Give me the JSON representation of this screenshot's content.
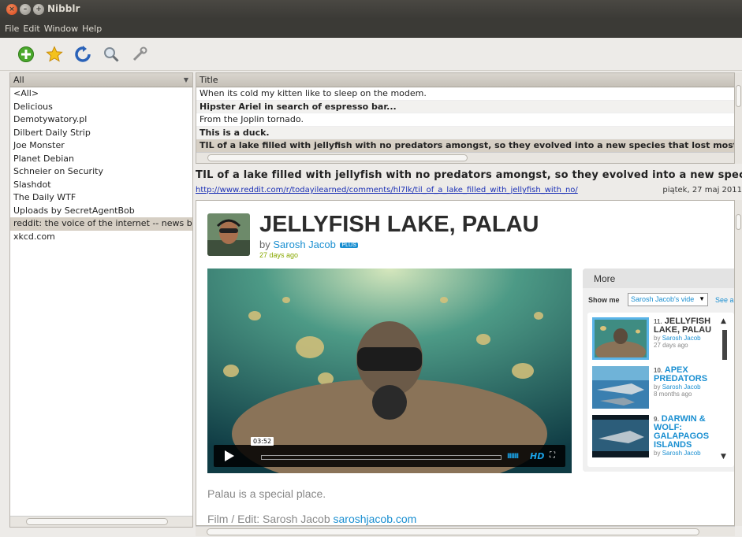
{
  "window": {
    "title": "Nibblr"
  },
  "menu": [
    "File",
    "Edit",
    "Window",
    "Help"
  ],
  "toolbar": {
    "icons": [
      "add-feed-icon",
      "star-icon",
      "refresh-icon",
      "search-icon",
      "settings-icon"
    ]
  },
  "sidebar": {
    "selector_value": "All",
    "feeds": [
      "<All>",
      "Delicious",
      "Demotywatory.pl",
      "Dilbert Daily Strip",
      "Joe Monster",
      "Planet Debian",
      "Schneier on Security",
      "Slashdot",
      "The Daily WTF",
      "Uploads by SecretAgentBob",
      "reddit: the voice of the internet -- news before it",
      "xkcd.com"
    ],
    "selected_index": 10
  },
  "articles": {
    "column_title": "Title",
    "rows": [
      {
        "title": "When its cold my kitten like to sleep on the modem.",
        "unread": false
      },
      {
        "title": "Hipster Ariel in search of espresso bar...",
        "unread": true
      },
      {
        "title": "From the Joplin tornado.",
        "unread": false
      },
      {
        "title": "This is a duck.",
        "unread": true
      },
      {
        "title": "TIL of a lake filled with jellyfish with no predators amongst, so they evolved into a new species that lost most of their stinging",
        "unread": true
      }
    ],
    "selected_index": 4
  },
  "article": {
    "title": "TIL of a lake filled with jellyfish with no predators amongst, so they evolved into a new species that lost most of their stinging",
    "link": "http://www.reddit.com/r/todayilearned/comments/hl7lk/til_of_a_lake_filled_with_jellyfish_with_no/",
    "date": "piątek, 27 maj 2011"
  },
  "webpage": {
    "video_title": "JELLYFISH LAKE, PALAU",
    "by_prefix": "by",
    "author": "Sarosh Jacob",
    "plus_badge": "PLUS",
    "posted_ago": "27 days ago",
    "player": {
      "timecode": "03:52",
      "hd_label": "HD",
      "volume_bars": "IIIIII"
    },
    "more_panel": {
      "tab_label": "More",
      "show_me_label": "Show me",
      "show_me_value": "Sarosh Jacob's vide",
      "see_all_label": "See al",
      "videos": [
        {
          "number": "11.",
          "title": "JELLYFISH LAKE, PALAU",
          "by": "by",
          "author": "Sarosh Jacob",
          "ago": "27 days ago"
        },
        {
          "number": "10.",
          "title": "APEX PREDATORS",
          "by": "by",
          "author": "Sarosh Jacob",
          "ago": "8 months ago"
        },
        {
          "number": "9.",
          "title": "DARWIN & WOLF: GALAPAGOS ISLANDS",
          "by": "by",
          "author": "Sarosh Jacob",
          "ago": ""
        }
      ]
    },
    "description": "Palau is a special place.",
    "credit_prefix": "Film / Edit: Sarosh Jacob",
    "credit_link": "saroshjacob.com"
  },
  "colors": {
    "selection": "#d6cfc4",
    "link_blue": "#1a8fd1",
    "titlebar": "#3b3a36"
  }
}
